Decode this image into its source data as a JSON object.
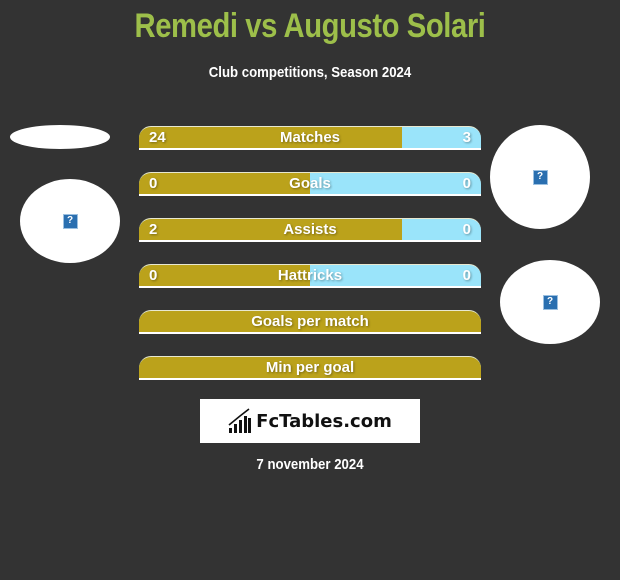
{
  "header": {
    "title": "Remedi vs Augusto Solari",
    "subtitle": "Club competitions, Season 2024"
  },
  "colors": {
    "background": "#333333",
    "title": "#9dbf4a",
    "left_bar": "#bba21b",
    "right_bar": "#9ae4fa"
  },
  "players": {
    "left": {
      "avatar_icon": "broken-image-icon"
    },
    "right": {
      "avatar_icon": "broken-image-icon"
    }
  },
  "stats": [
    {
      "label": "Matches",
      "left": "24",
      "right": "3",
      "left_share": 0.77
    },
    {
      "label": "Goals",
      "left": "0",
      "right": "0",
      "left_share": 0.5
    },
    {
      "label": "Assists",
      "left": "2",
      "right": "0",
      "left_share": 0.77
    },
    {
      "label": "Hattricks",
      "left": "0",
      "right": "0",
      "left_share": 0.5
    },
    {
      "label": "Goals per match",
      "left": "",
      "right": "",
      "left_share": 1.0
    },
    {
      "label": "Min per goal",
      "left": "",
      "right": "",
      "left_share": 1.0
    }
  ],
  "footer": {
    "logo_text": "FcTables.com",
    "date": "7 november 2024"
  }
}
